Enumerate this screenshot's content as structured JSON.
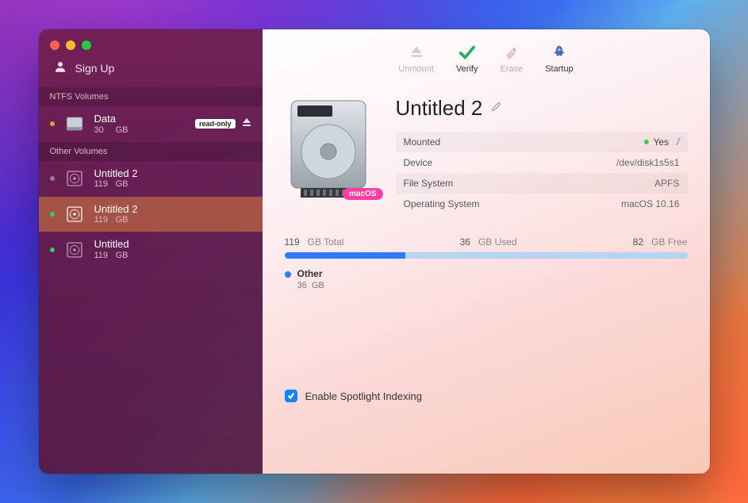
{
  "sidebar": {
    "signup_label": "Sign Up",
    "sections": [
      {
        "header": "NTFS Volumes",
        "items": [
          {
            "name": "Data",
            "size_num": "30",
            "size_unit": "GB",
            "status": "orange",
            "badge": "read-only",
            "eject": true,
            "icon": "ext"
          }
        ]
      },
      {
        "header": "Other Volumes",
        "items": [
          {
            "name": "Untitled 2",
            "size_num": "119",
            "size_unit": "GB",
            "status": "grey",
            "icon": "int"
          },
          {
            "name": "Untitled 2",
            "size_num": "119",
            "size_unit": "GB",
            "status": "green",
            "icon": "int",
            "selected": true
          },
          {
            "name": "Untitled",
            "size_num": "119",
            "size_unit": "GB",
            "status": "green",
            "icon": "int"
          }
        ]
      }
    ]
  },
  "toolbar": {
    "unmount": "Unmount",
    "verify": "Verify",
    "erase": "Erase",
    "startup": "Startup"
  },
  "volume": {
    "title": "Untitled 2",
    "mac_badge": "macOS",
    "rows": {
      "mounted_label": "Mounted",
      "mounted_value": "Yes",
      "mount_point": "/",
      "device_label": "Device",
      "device_value": "/dev/disk1s5s1",
      "fs_label": "File System",
      "fs_value": "APFS",
      "os_label": "Operating System",
      "os_value": "macOS 10.16"
    }
  },
  "storage": {
    "total_num": "119",
    "total_unit": "GB Total",
    "used_num": "36",
    "used_unit": "GB Used",
    "free_num": "82",
    "free_unit": "GB Free",
    "used_pct": 30,
    "legend_label": "Other",
    "legend_num": "36",
    "legend_unit": "GB"
  },
  "spotlight_label": "Enable Spotlight Indexing"
}
